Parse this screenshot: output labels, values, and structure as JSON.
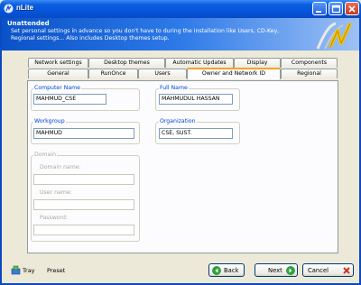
{
  "window": {
    "title": "nLite",
    "controls": [
      "minimize",
      "maximize",
      "close"
    ]
  },
  "header": {
    "title": "Unattended",
    "description": "Set personal settings in advance so you don't have to during the installation like Users, CD-Key, Regional settings... Also includes Desktop themes setup."
  },
  "tabs": {
    "row1": [
      "Network settings",
      "Desktop themes",
      "Automatic Updates",
      "Display",
      "Components"
    ],
    "row2": [
      "General",
      "RunOnce",
      "Users",
      "Owner and Network ID",
      "Regional"
    ],
    "active": "Owner and Network ID"
  },
  "form": {
    "computer_name": {
      "label": "Computer Name",
      "value": "MAHMUD_CSE"
    },
    "full_name": {
      "label": "Full Name",
      "value": "MAHMUDUL HASSAN"
    },
    "workgroup": {
      "label": "Workgroup",
      "value": "MAHMUD"
    },
    "organization": {
      "label": "Organization",
      "value": "CSE, SUST."
    },
    "domain": {
      "label": "Domain",
      "domain_name_label": "Domain name:",
      "user_name_label": "User name:",
      "password_label": "Password:",
      "domain_name_value": "",
      "user_name_value": "",
      "password_value": ""
    }
  },
  "footer": {
    "tray": "Tray",
    "preset": "Preset",
    "back": "Back",
    "next": "Next",
    "cancel": "Cancel"
  },
  "colors": {
    "titlebar": "#0553d8",
    "group_label": "#0046d5",
    "active_tab_accent": "#f6a22a",
    "back_next_icon": "#2aa53a",
    "cancel_icon": "#d03020"
  },
  "icons": {
    "app": "nlite-icon",
    "tray": "tray-icon",
    "back": "back-arrow-icon",
    "next": "next-arrow-icon",
    "cancel": "cancel-x-icon"
  }
}
